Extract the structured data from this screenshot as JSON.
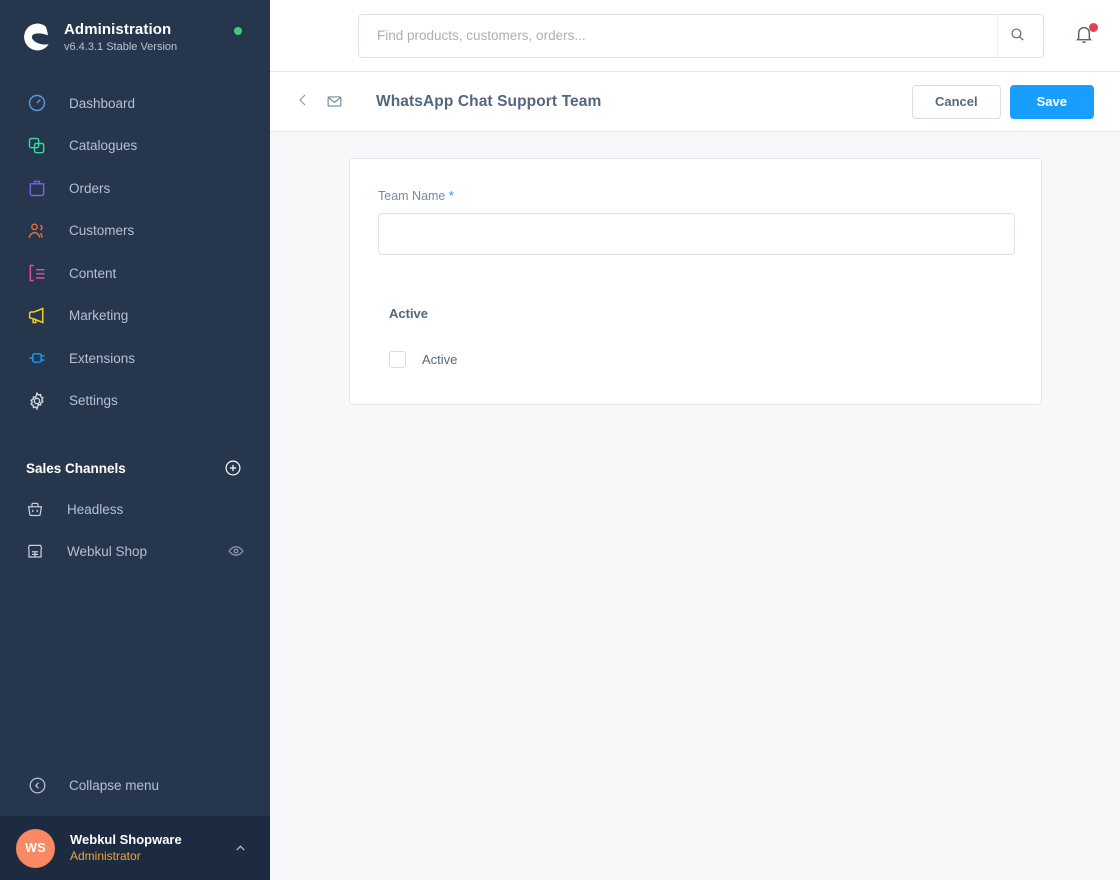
{
  "sidebar": {
    "brand": {
      "title": "Administration",
      "version": "v6.4.3.1 Stable Version",
      "logo_icon": "shopware-logo-icon",
      "status_color": "#37d275"
    },
    "nav": [
      {
        "label": "Dashboard",
        "icon": "dashboard-icon",
        "color": "#5d9ae0"
      },
      {
        "label": "Catalogues",
        "icon": "catalogues-icon",
        "color": "#37d9a0"
      },
      {
        "label": "Orders",
        "icon": "orders-icon",
        "color": "#7b61e8"
      },
      {
        "label": "Customers",
        "icon": "customers-icon",
        "color": "#e86f3c"
      },
      {
        "label": "Content",
        "icon": "content-icon",
        "color": "#ee4d9b"
      },
      {
        "label": "Marketing",
        "icon": "marketing-icon",
        "color": "#f2d024"
      },
      {
        "label": "Extensions",
        "icon": "extensions-icon",
        "color": "#189eff"
      },
      {
        "label": "Settings",
        "icon": "settings-icon",
        "color": "#cdd4dc"
      }
    ],
    "sales_channels": {
      "title": "Sales Channels",
      "add_icon": "plus-circle-icon",
      "items": [
        {
          "label": "Headless",
          "icon": "basket-icon",
          "trailing_icon": ""
        },
        {
          "label": "Webkul Shop",
          "icon": "storefront-icon",
          "trailing_icon": "eye-icon"
        }
      ]
    },
    "collapse": {
      "label": "Collapse menu",
      "icon": "collapse-left-icon"
    },
    "user": {
      "initials": "WS",
      "name": "Webkul Shopware",
      "role": "Administrator",
      "caret_icon": "chevron-up-icon",
      "avatar_color": "#f88962"
    }
  },
  "topbar": {
    "search_placeholder": "Find products, customers, orders...",
    "search_value": "",
    "search_icon": "search-icon",
    "notifications_icon": "bell-icon",
    "notifications_has_badge": true,
    "badge_color": "#e2404f"
  },
  "pagehead": {
    "back_icon": "chevron-left-icon",
    "module_icon": "inbox-icon",
    "title": "WhatsApp Chat Support Team",
    "cancel_label": "Cancel",
    "save_label": "Save",
    "save_color": "#189eff"
  },
  "form": {
    "team_name": {
      "label": "Team Name",
      "required_marker": "*",
      "value": "",
      "placeholder": ""
    },
    "active_section": {
      "title": "Active",
      "checkbox_label": "Active",
      "checked": false
    }
  }
}
